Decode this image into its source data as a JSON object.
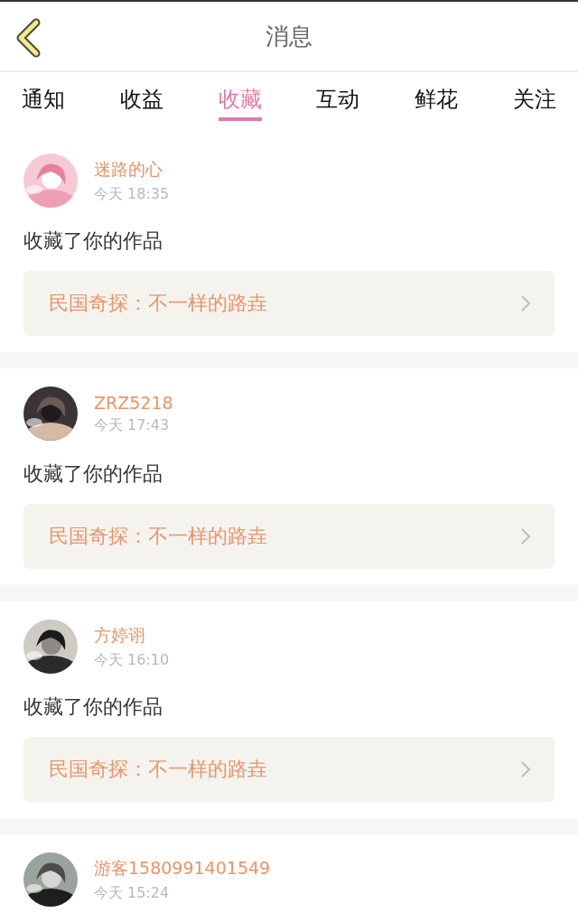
{
  "header": {
    "title": "消息"
  },
  "tabs": [
    {
      "label": "通知",
      "selected": false
    },
    {
      "label": "收益",
      "selected": false
    },
    {
      "label": "收藏",
      "selected": true
    },
    {
      "label": "互动",
      "selected": false
    },
    {
      "label": "鲜花",
      "selected": false
    },
    {
      "label": "关注",
      "selected": false
    }
  ],
  "messages": [
    {
      "user": "迷路的心",
      "time": "今天 18:35",
      "text": "收藏了你的作品",
      "work": "民国奇探：不一样的路垚"
    },
    {
      "user": "ZRZ5218",
      "time": "今天 17:43",
      "text": "收藏了你的作品",
      "work": "民国奇探：不一样的路垚"
    },
    {
      "user": "方婷诩",
      "time": "今天 16:10",
      "text": "收藏了你的作品",
      "work": "民国奇探：不一样的路垚"
    },
    {
      "user": "游客1580991401549",
      "time": "今天 15:24"
    }
  ]
}
